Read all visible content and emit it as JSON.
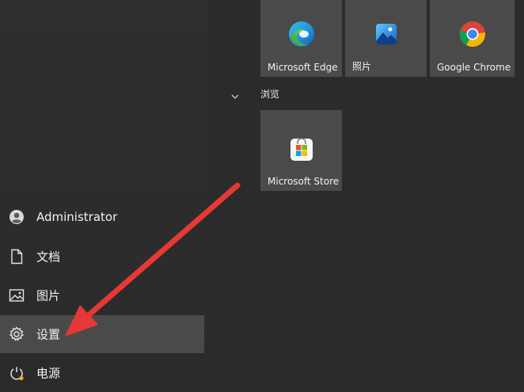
{
  "user": {
    "name": "Administrator"
  },
  "nav": {
    "documents": "文档",
    "pictures": "图片",
    "settings": "设置",
    "power": "电源"
  },
  "tiles": {
    "edge": "Microsoft Edge",
    "photos": "照片",
    "chrome": "Google Chrome",
    "store": "Microsoft Store"
  },
  "groups": {
    "browse": "浏览"
  },
  "icons": [
    "user-icon",
    "document-icon",
    "picture-icon",
    "gear-icon",
    "power-icon",
    "edge-icon",
    "photos-icon",
    "chrome-icon",
    "store-icon",
    "chevron-down-icon"
  ],
  "colors": {
    "annotation_arrow": "#e53935",
    "tile_bg": "#4a4a4a",
    "background": "#2b2b2b"
  }
}
